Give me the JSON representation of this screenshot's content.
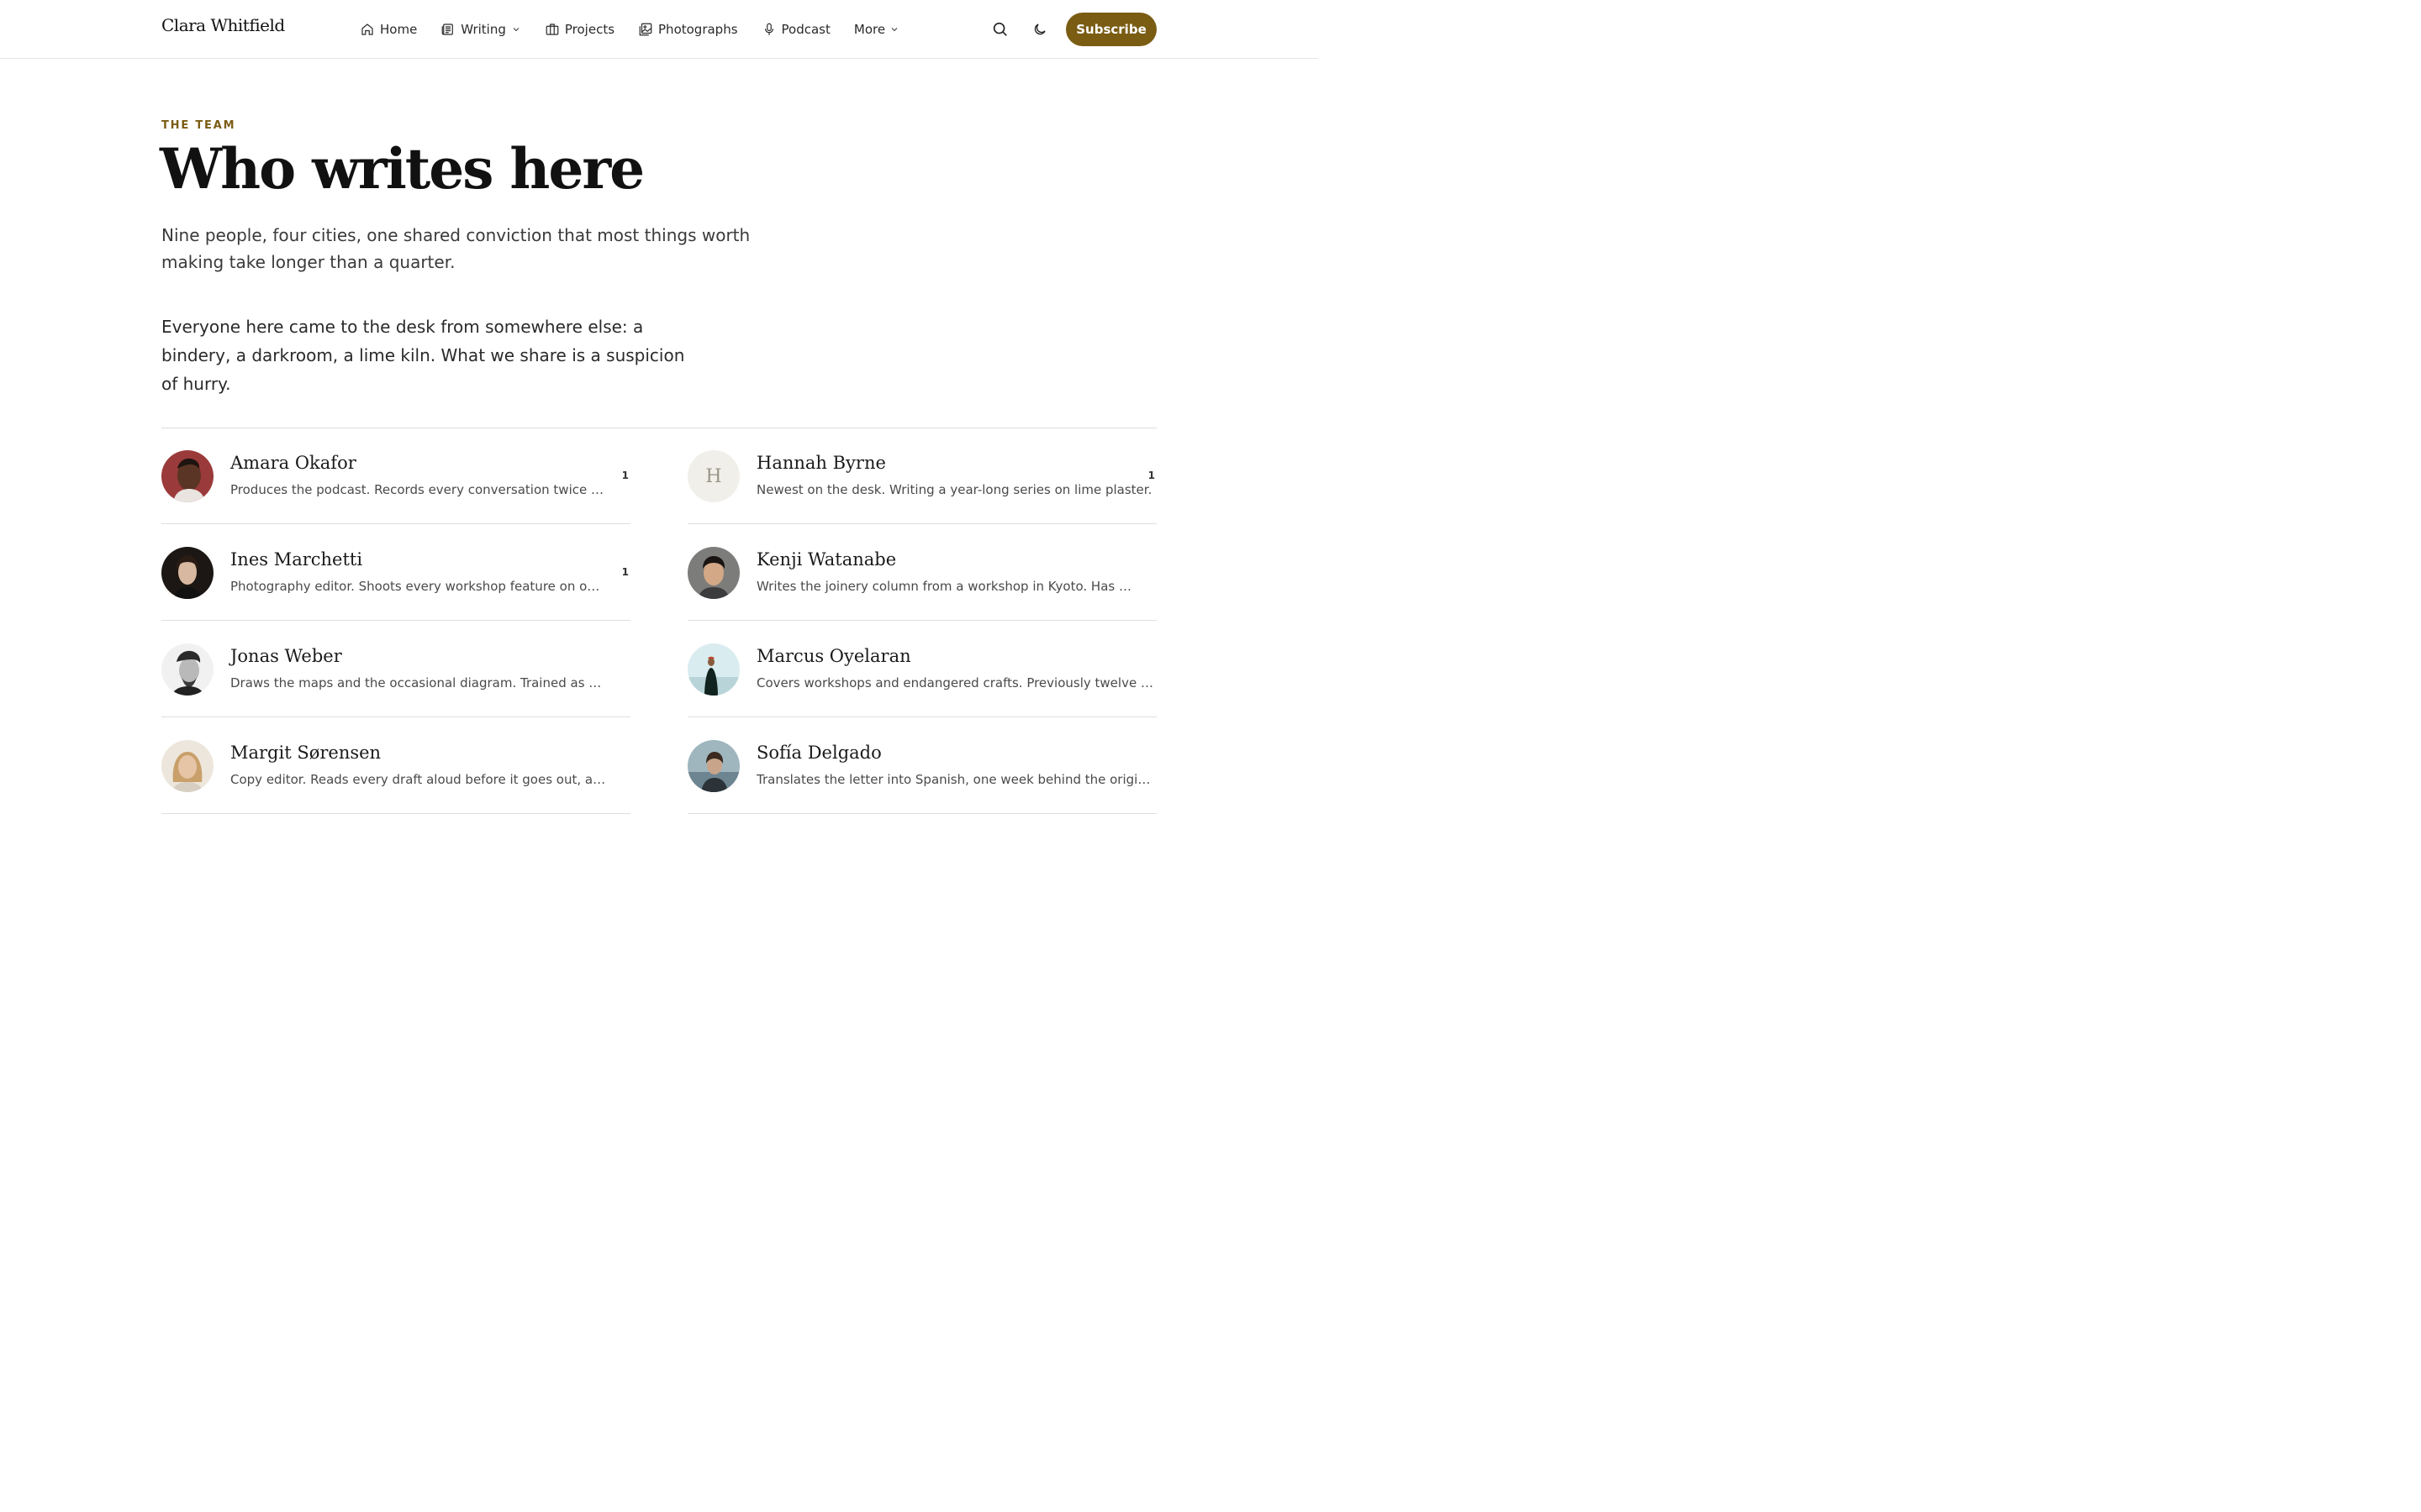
{
  "header": {
    "brand": "Clara Whitfield",
    "nav": [
      {
        "label": "Home",
        "icon": "home-icon"
      },
      {
        "label": "Writing",
        "icon": "newspaper-icon",
        "has_dropdown": true
      },
      {
        "label": "Projects",
        "icon": "briefcase-icon"
      },
      {
        "label": "Photographs",
        "icon": "image-icon"
      },
      {
        "label": "Podcast",
        "icon": "microphone-icon"
      },
      {
        "label": "More",
        "has_dropdown": true
      }
    ],
    "search_icon": "search-icon",
    "theme_icon": "moon-icon",
    "subscribe_label": "Subscribe"
  },
  "hero": {
    "eyebrow": "THE TEAM",
    "title": "Who writes here",
    "lede": "Nine people, four cities, one shared conviction that most things worth making take longer than a quarter.",
    "body": "Everyone here came to the desk from somewhere else: a bindery, a darkroom, a lime kiln. What we share is a suspicion of hurry."
  },
  "team": [
    {
      "name": "Amara Okafor",
      "bio": "Produces the podcast. Records every conversation twice and...",
      "count": "1",
      "avatar": "photo"
    },
    {
      "name": "Hannah Byrne",
      "bio": "Newest on the desk. Writing a year-long series on lime plaster.",
      "count": "1",
      "avatar": "initial",
      "initial": "H"
    },
    {
      "name": "Ines Marchetti",
      "bio": "Photography editor. Shoots every workshop feature on one...",
      "count": "1",
      "avatar": "photo"
    },
    {
      "name": "Kenji Watanabe",
      "bio": "Writes the joinery column from a workshop in Kyoto. Has never...",
      "count": "",
      "avatar": "photo"
    },
    {
      "name": "Jonas Weber",
      "bio": "Draws the maps and the occasional diagram. Trained as a...",
      "count": "",
      "avatar": "photo"
    },
    {
      "name": "Marcus Oyelaran",
      "bio": "Covers workshops and endangered crafts. Previously twelve years...",
      "count": "",
      "avatar": "photo"
    },
    {
      "name": "Margit Sørensen",
      "bio": "Copy editor. Reads every draft aloud before it goes out, and has...",
      "count": "",
      "avatar": "photo"
    },
    {
      "name": "Sofía Delgado",
      "bio": "Translates the letter into Spanish, one week behind the original, on...",
      "count": "",
      "avatar": "photo"
    }
  ],
  "colors": {
    "accent": "#7a5c13",
    "rule": "#dedede",
    "text": "#1c1c1c"
  }
}
